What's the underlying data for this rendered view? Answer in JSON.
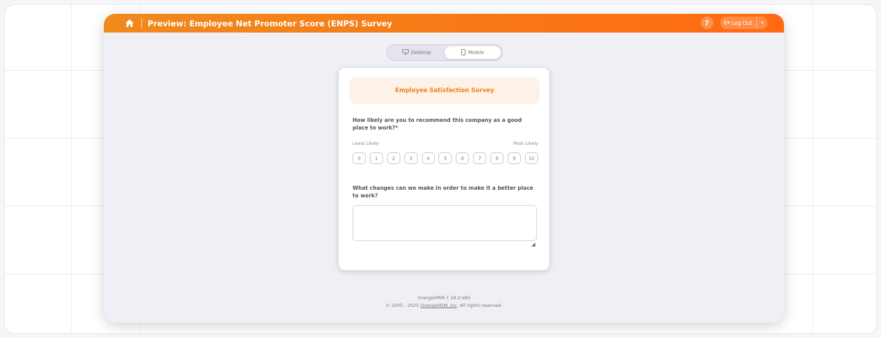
{
  "header": {
    "title": "Preview: Employee Net Promoter Score (ENPS) Survey",
    "help_label": "?",
    "logout_label": "Log Out",
    "home_icon": "home-icon",
    "logout_icon": "logout-icon",
    "dropdown_icon": "chevron-down-icon"
  },
  "view_toggle": {
    "options": [
      {
        "label": "Desktop",
        "icon": "monitor-icon"
      },
      {
        "label": "Mobile",
        "icon": "phone-icon",
        "selected": true
      }
    ]
  },
  "survey": {
    "title": "Employee Satisfaction Survey",
    "question1": "How likely are you to recommend this company as a good place to work?*",
    "least_label": "Least Likely",
    "most_label": "Most Likely",
    "scale": [
      "0",
      "1",
      "2",
      "3",
      "4",
      "5",
      "6",
      "7",
      "8",
      "9",
      "10"
    ],
    "question2": "What changes can we make in order to make it a better place to work?",
    "answer_value": ""
  },
  "footer": {
    "version": "OrangeHRM 7.18.2-VAS",
    "copyright_prefix": "© 2005 - 2025 ",
    "company_link": "OrangeHRM, Inc",
    "copyright_suffix": ". All rights reserved."
  },
  "colors": {
    "accent": "#ff7b1d",
    "accent_light": "#fdf1e8",
    "background": "#efeff6"
  }
}
